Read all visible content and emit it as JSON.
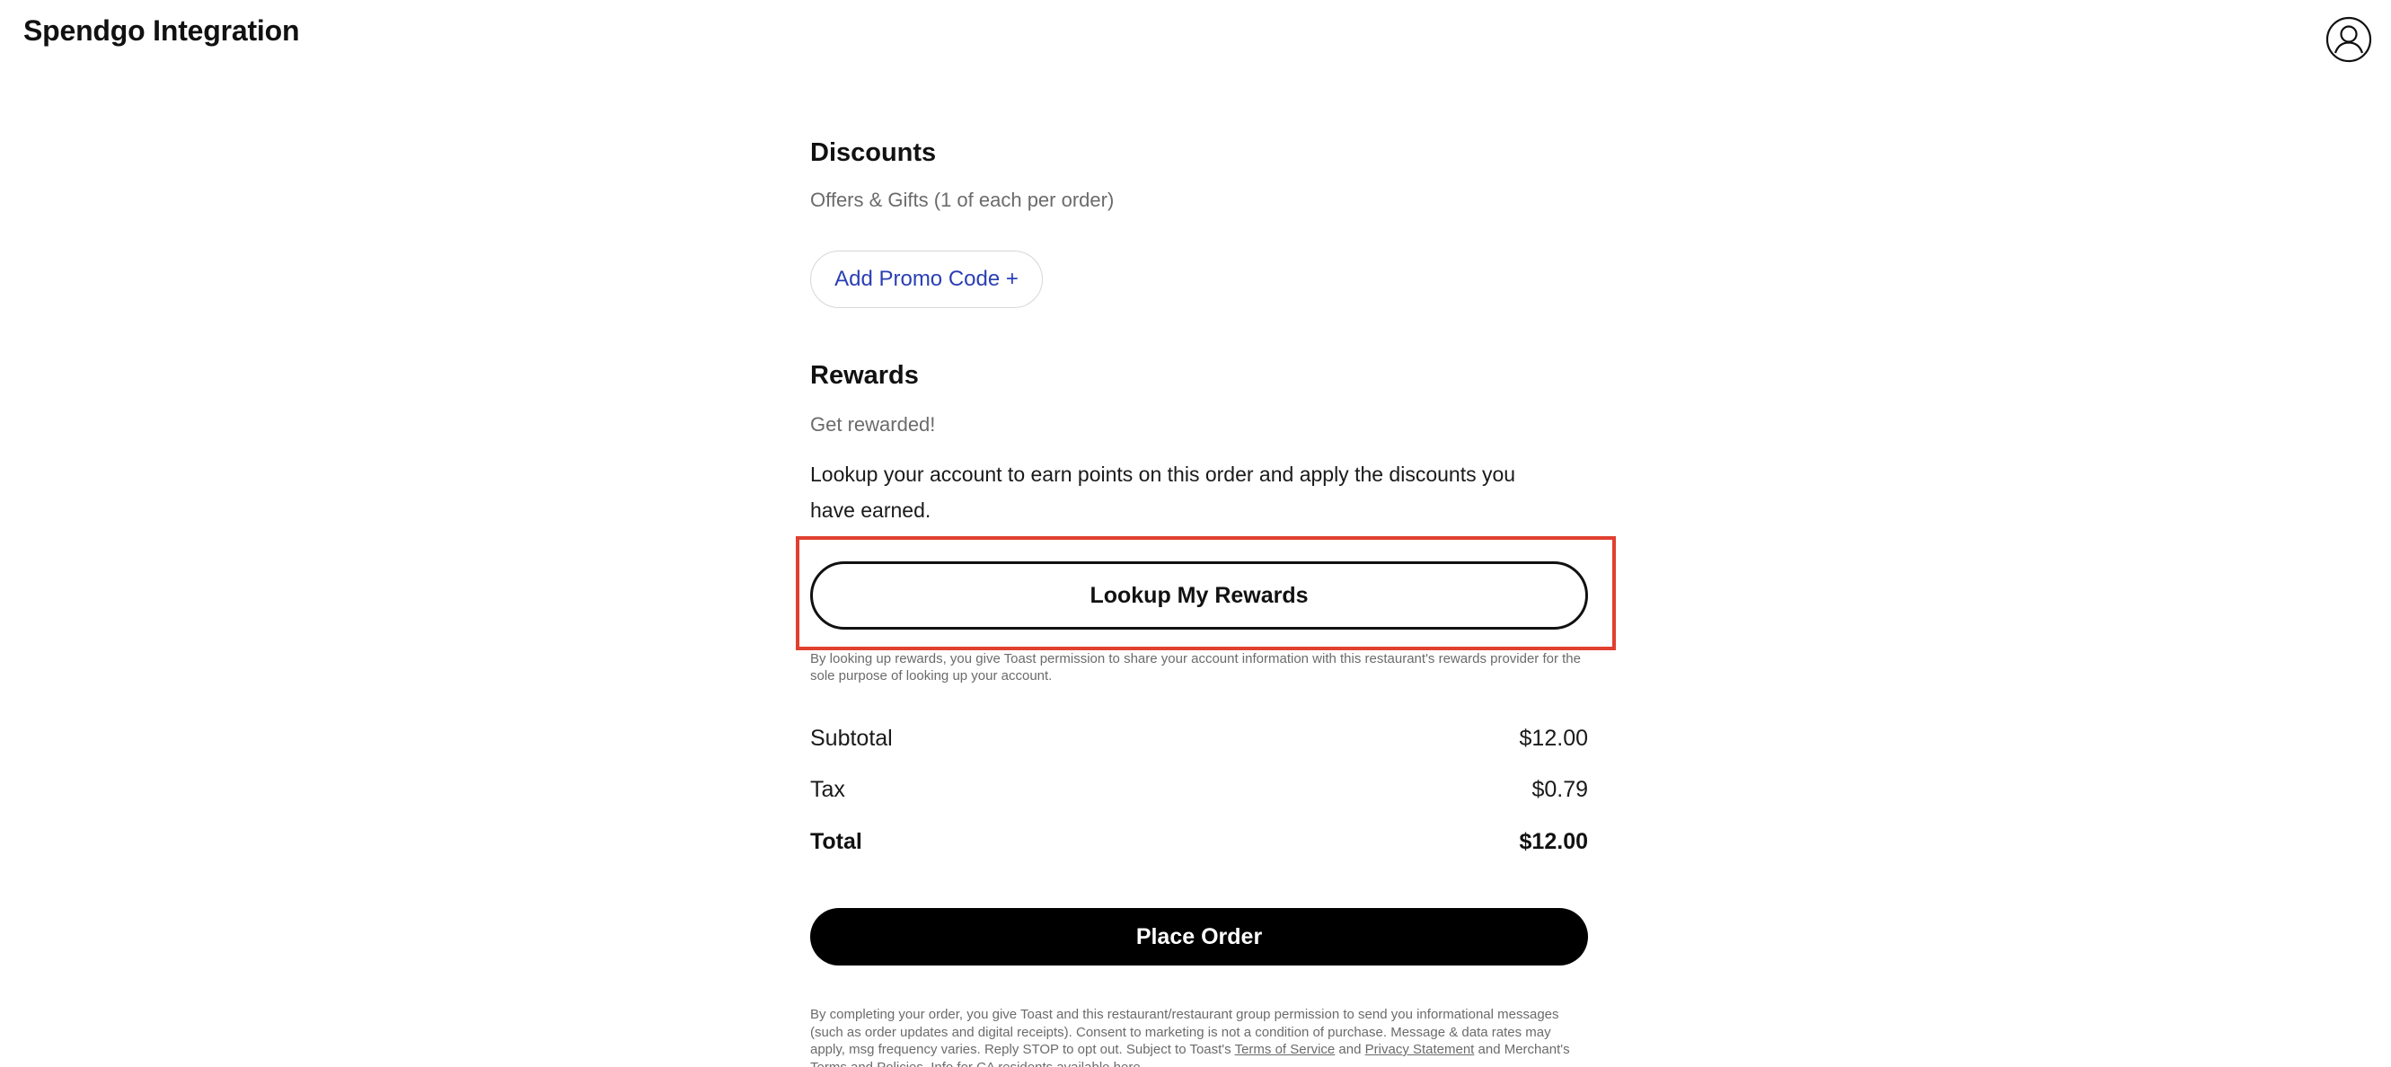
{
  "header": {
    "title": "Spendgo Integration",
    "account_icon": "user-circle-icon"
  },
  "discounts": {
    "title": "Discounts",
    "subtitle": "Offers & Gifts (1 of each per order)",
    "promo_button_label": "Add Promo Code +"
  },
  "rewards": {
    "title": "Rewards",
    "subtitle": "Get rewarded!",
    "description": "Lookup your account to earn points on this order and apply the discounts you have earned.",
    "lookup_button_label": "Lookup My Rewards",
    "disclaimer": "By looking up rewards, you give Toast permission to share your account information with this restaurant's rewards provider for the sole purpose of looking up your account."
  },
  "totals": {
    "subtotal_label": "Subtotal",
    "subtotal_value": "$12.00",
    "tax_label": "Tax",
    "tax_value": "$0.79",
    "total_label": "Total",
    "total_value": "$12.00"
  },
  "order": {
    "place_order_label": "Place Order",
    "legal_part1": "By completing your order, you give Toast and this restaurant/restaurant group permission to send you informational messages (such as order updates and digital receipts). Consent to marketing is not a condition of purchase. Message & data rates may apply, msg frequency varies. Reply STOP to opt out. Subject to Toast's ",
    "terms_link": "Terms of Service",
    "legal_and": " and ",
    "privacy_link": "Privacy Statement",
    "legal_part2": " and Merchant's Terms and Policies. Info for CA residents available here."
  },
  "colors": {
    "accent_link": "#2b3fb5",
    "highlight": "#e0402f",
    "primary_button": "#000000"
  }
}
